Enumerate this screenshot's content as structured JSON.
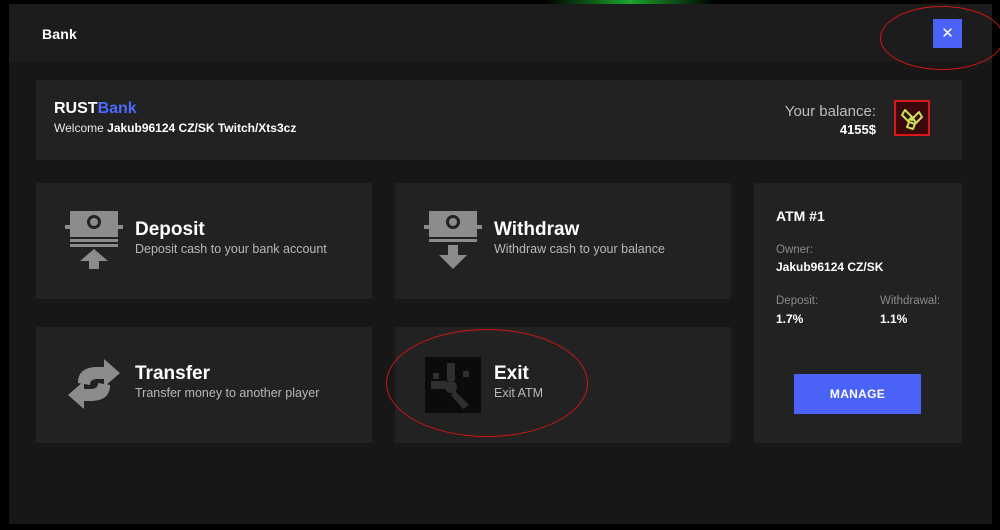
{
  "header": {
    "title": "Bank",
    "close_icon": "close-icon",
    "close_glyph": "✕"
  },
  "info": {
    "brand_part1": "RUST",
    "brand_part2": "Bank",
    "welcome_prefix": "Welcome ",
    "username": "Jakub96124 CZ/SK Twitch/Xts3cz",
    "balance_label": "Your balance:",
    "balance_value": "4155$",
    "balance_icon": "scrap-icon"
  },
  "tiles": [
    {
      "title": "Deposit",
      "description": "Deposit cash to your bank account",
      "icon": "deposit-icon"
    },
    {
      "title": "Withdraw",
      "description": "Withdraw cash to your balance",
      "icon": "withdraw-icon"
    },
    {
      "title": "Transfer",
      "description": "Transfer money to another player",
      "icon": "transfer-icon"
    },
    {
      "title": "Exit",
      "description": "Exit ATM",
      "icon": "rust-logo-icon"
    }
  ],
  "atm": {
    "title": "ATM #1",
    "owner_label": "Owner:",
    "owner_value": "Jakub96124 CZ/SK",
    "deposit_label": "Deposit:",
    "deposit_value": "1.7%",
    "withdrawal_label": "Withdrawal:",
    "withdrawal_value": "1.1%",
    "manage_label": "MANAGE"
  },
  "colors": {
    "accent": "#4b62f7",
    "brand_blue": "#4b6bff",
    "panel": "#222222",
    "background": "#171717",
    "annotation_red": "#d01515"
  }
}
